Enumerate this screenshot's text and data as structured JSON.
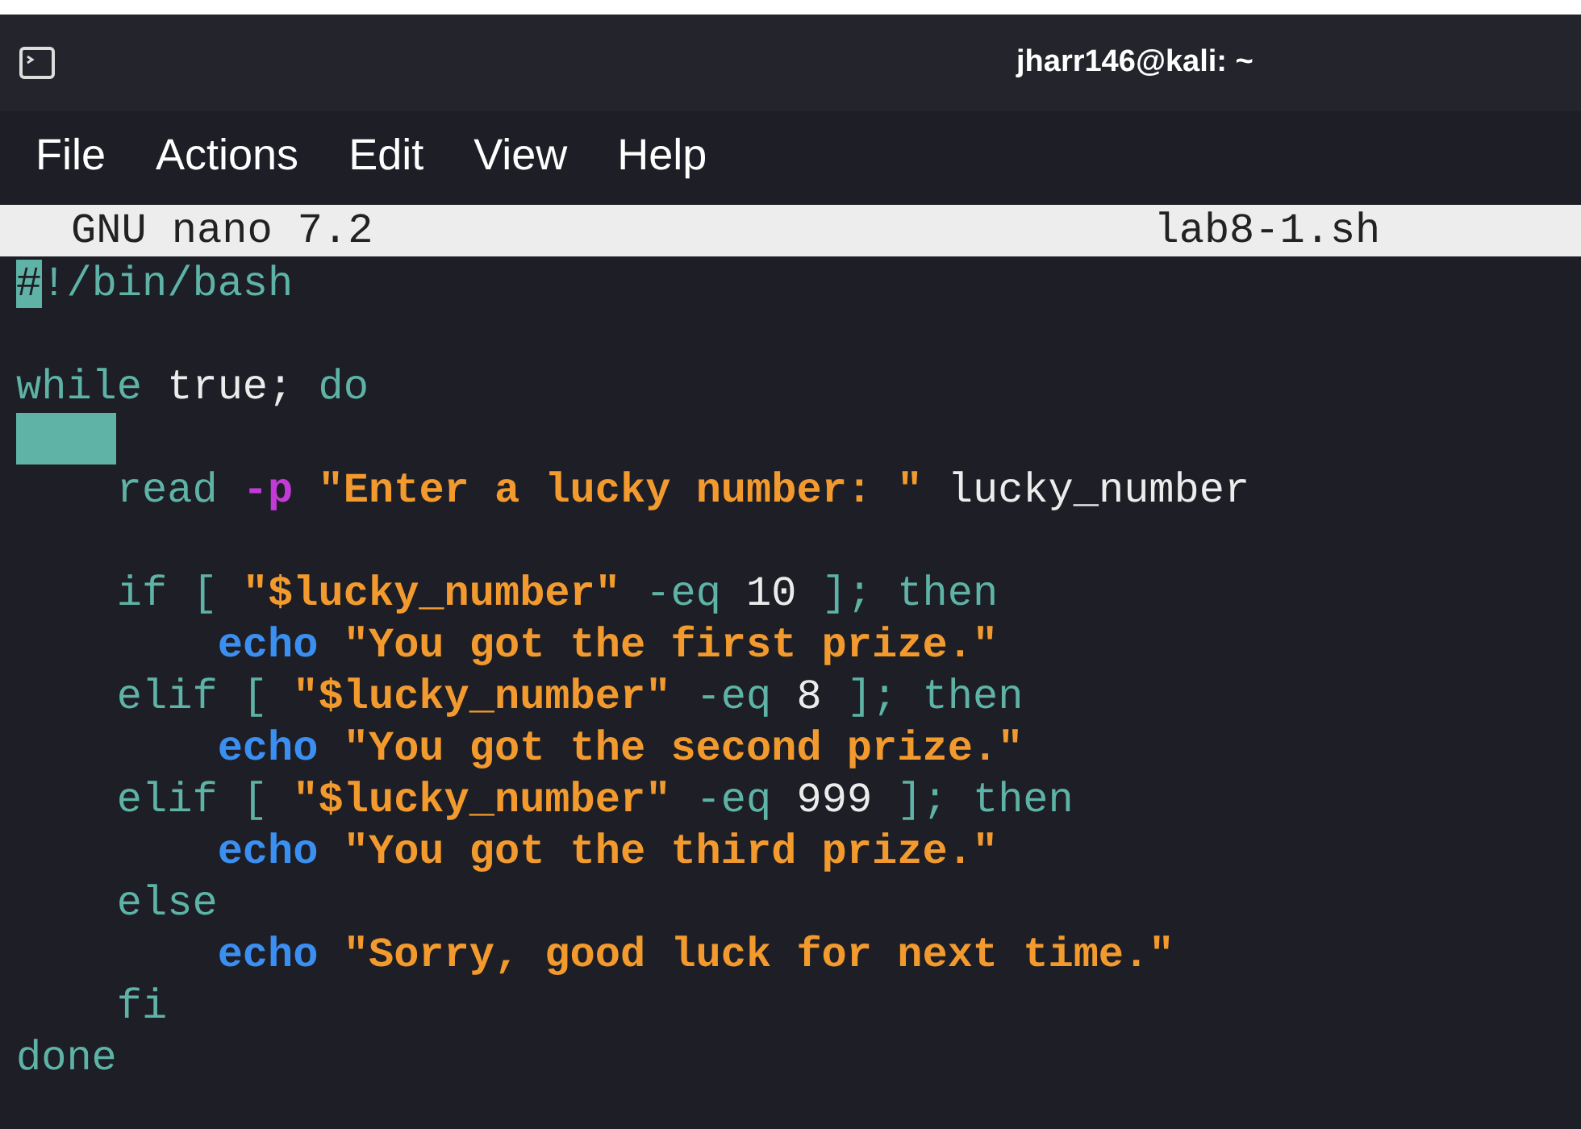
{
  "window": {
    "title": "jharr146@kali: ~"
  },
  "menu": [
    "File",
    "Actions",
    "Edit",
    "View",
    "Help"
  ],
  "nano_header": {
    "version": "GNU nano 7.2",
    "filename": "lab8-1.sh"
  },
  "lines": [
    {
      "kind": "code",
      "segments": [
        {
          "kind": "cursor",
          "text": "#"
        },
        {
          "kind": "keyword",
          "text": "!/bin/bash"
        }
      ]
    },
    {
      "kind": "blank"
    },
    {
      "kind": "code",
      "segments": [
        {
          "kind": "keyword",
          "text": "while"
        },
        {
          "kind": "plain",
          "text": " true; "
        },
        {
          "kind": "keyword",
          "text": "do"
        }
      ]
    },
    {
      "kind": "whitespace"
    },
    {
      "kind": "code",
      "segments": [
        {
          "kind": "keyword",
          "text": "    read "
        },
        {
          "kind": "option",
          "text": "-p"
        },
        {
          "kind": "string",
          "text": " \"Enter a lucky number: \""
        },
        {
          "kind": "plain",
          "text": " lucky_number"
        }
      ]
    },
    {
      "kind": "blank"
    },
    {
      "kind": "code",
      "segments": [
        {
          "kind": "keyword",
          "text": "    if [ "
        },
        {
          "kind": "string",
          "text": "\"$lucky_number\""
        },
        {
          "kind": "keyword",
          "text": " -eq "
        },
        {
          "kind": "plain",
          "text": "10"
        },
        {
          "kind": "keyword",
          "text": " ]; then"
        }
      ]
    },
    {
      "kind": "code",
      "segments": [
        {
          "kind": "builtin",
          "text": "        echo"
        },
        {
          "kind": "string",
          "text": " \"You got the first prize.\""
        }
      ]
    },
    {
      "kind": "code",
      "segments": [
        {
          "kind": "keyword",
          "text": "    elif [ "
        },
        {
          "kind": "string",
          "text": "\"$lucky_number\""
        },
        {
          "kind": "keyword",
          "text": " -eq "
        },
        {
          "kind": "plain",
          "text": "8"
        },
        {
          "kind": "keyword",
          "text": " ]; then"
        }
      ]
    },
    {
      "kind": "code",
      "segments": [
        {
          "kind": "builtin",
          "text": "        echo"
        },
        {
          "kind": "string",
          "text": " \"You got the second prize.\""
        }
      ]
    },
    {
      "kind": "code",
      "segments": [
        {
          "kind": "keyword",
          "text": "    elif [ "
        },
        {
          "kind": "string",
          "text": "\"$lucky_number\""
        },
        {
          "kind": "keyword",
          "text": " -eq "
        },
        {
          "kind": "plain",
          "text": "999"
        },
        {
          "kind": "keyword",
          "text": " ]; then"
        }
      ]
    },
    {
      "kind": "code",
      "segments": [
        {
          "kind": "builtin",
          "text": "        echo"
        },
        {
          "kind": "string",
          "text": " \"You got the third prize.\""
        }
      ]
    },
    {
      "kind": "code",
      "segments": [
        {
          "kind": "keyword",
          "text": "    else"
        }
      ]
    },
    {
      "kind": "code",
      "segments": [
        {
          "kind": "builtin",
          "text": "        echo"
        },
        {
          "kind": "string",
          "text": " \"Sorry, good luck for next time.\""
        }
      ]
    },
    {
      "kind": "code",
      "segments": [
        {
          "kind": "keyword",
          "text": "    fi"
        }
      ]
    },
    {
      "kind": "code",
      "segments": [
        {
          "kind": "keyword",
          "text": "done"
        }
      ]
    }
  ]
}
